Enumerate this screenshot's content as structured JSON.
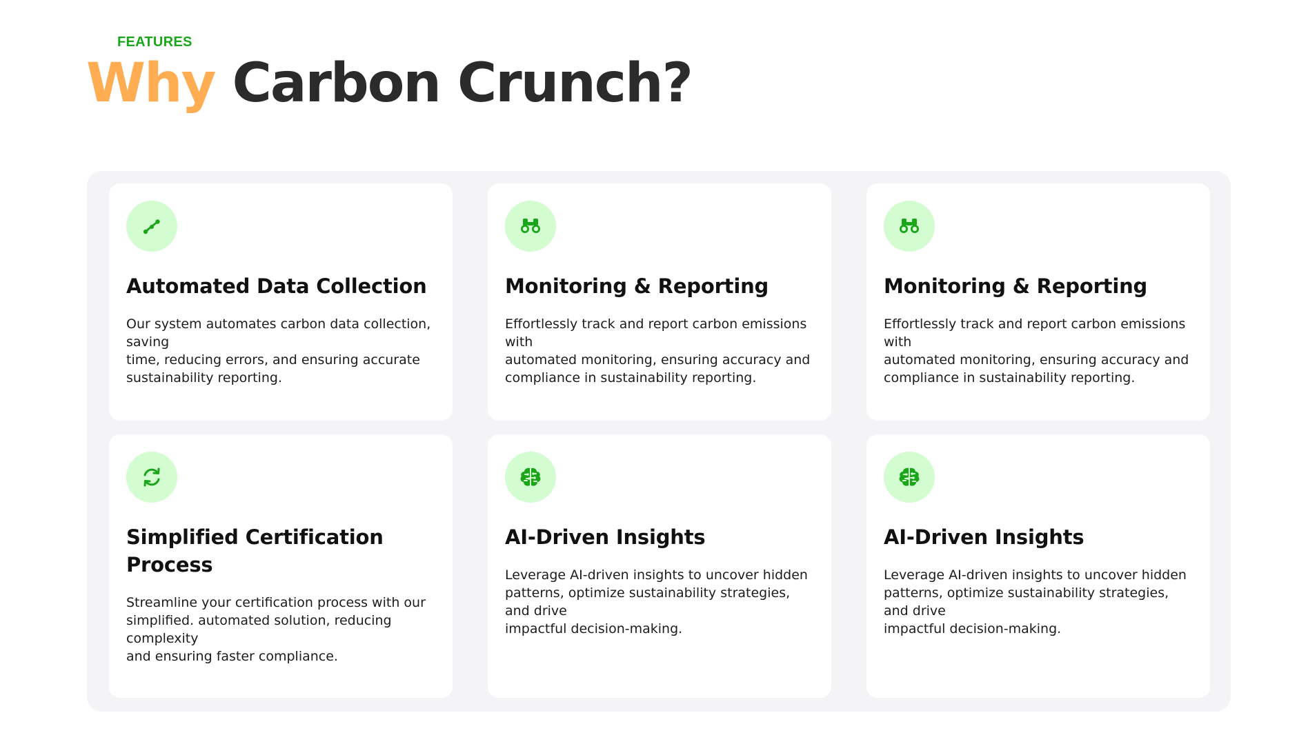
{
  "header": {
    "eyebrow": "FEATURES",
    "title_accent": "Why",
    "title_rest": "Carbon Crunch?"
  },
  "colors": {
    "accent": "#ffad52",
    "green": "#1aa51a",
    "icon_bg": "#d3fcd0",
    "panel_bg": "#f4f4f6"
  },
  "features": [
    {
      "icon": "data-collection-icon",
      "title": "Automated Data Collection",
      "lines": [
        "Our system automates carbon data collection, saving",
        "time, reducing errors, and ensuring accurate sustainability reporting."
      ]
    },
    {
      "icon": "binoculars-icon",
      "title": "Monitoring & Reporting",
      "lines": [
        "Effortlessly track and report carbon emissions with",
        "automated monitoring, ensuring accuracy and compliance in sustainability reporting."
      ]
    },
    {
      "icon": "binoculars-icon",
      "title": "Monitoring & Reporting",
      "lines": [
        "Effortlessly track and report carbon emissions with",
        "automated monitoring, ensuring accuracy and compliance in sustainability reporting."
      ]
    },
    {
      "icon": "refresh-icon",
      "title": "Simplified Certification Process",
      "lines": [
        "Streamline your certification process with our simplified. automated solution, reducing complexity",
        "and ensuring faster compliance."
      ]
    },
    {
      "icon": "brain-icon",
      "title": "AI-Driven Insights",
      "lines": [
        "Leverage AI-driven insights to uncover hidden patterns, optimize sustainability strategies, and drive",
        "impactful decision-making."
      ]
    },
    {
      "icon": "brain-icon",
      "title": "AI-Driven Insights",
      "lines": [
        "Leverage AI-driven insights to uncover hidden patterns, optimize sustainability strategies, and drive",
        "impactful decision-making."
      ]
    }
  ]
}
